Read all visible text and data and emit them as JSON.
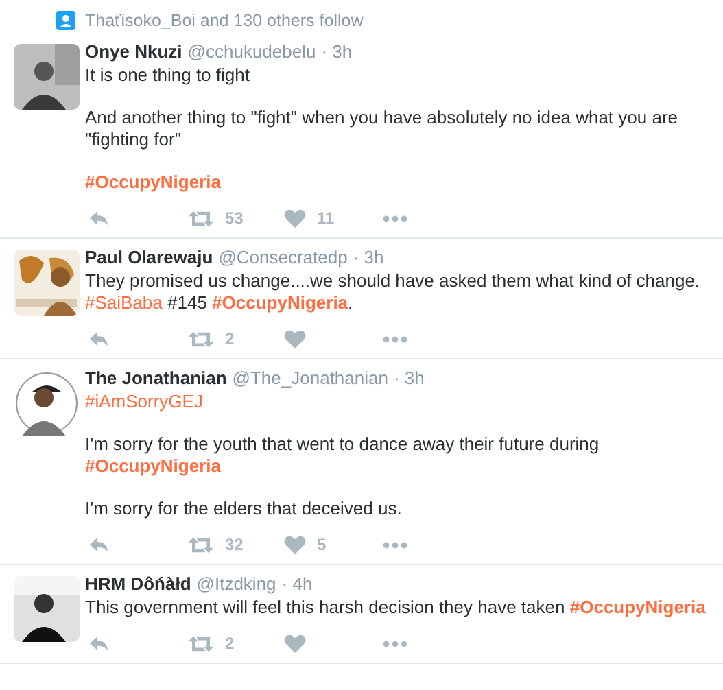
{
  "context": {
    "text": "Thaťisoko_Boi and 130 others follow"
  },
  "tweets": [
    {
      "name": "Onye Nkuzi",
      "handle": "@cchukudebelu",
      "time": "· 3h",
      "avatar": {
        "kind": "picture"
      },
      "paragraphs": [
        [
          {
            "kind": "text",
            "text": "It is one thing to fight"
          }
        ],
        [
          {
            "kind": "text",
            "text": "And another thing to \"fight\" when you have absolutely no idea what you are \"fighting for\""
          }
        ],
        [
          {
            "kind": "hashtag",
            "text": "**#OccupyNigeria**"
          }
        ]
      ],
      "retweets": "53",
      "likes": "11"
    },
    {
      "name": "Paul Olarewaju",
      "handle": "@Consecratedp",
      "time": "· 3h",
      "avatar": {
        "kind": "picture"
      },
      "paragraphs": [
        [
          {
            "kind": "text",
            "text": "They promised us change....we should have asked them what kind of change. "
          },
          {
            "kind": "hashtag",
            "text": "#SaiBaba"
          },
          {
            "kind": "text",
            "text": " #145 "
          },
          {
            "kind": "hashtag",
            "text": "**#OccupyNigeria**"
          },
          {
            "kind": "text",
            "text": "."
          }
        ]
      ],
      "retweets": "2"
    },
    {
      "name": "The Jonathanian",
      "handle": "@The_Jonathanian",
      "time": "· 3h",
      "avatar": {
        "kind": "picture"
      },
      "paragraphs": [
        [
          {
            "kind": "hashtag",
            "text": "#iAmSorryGEJ"
          }
        ],
        [
          {
            "kind": "text",
            "text": "I'm sorry for the youth that went to dance away their future during "
          },
          {
            "kind": "hashtag",
            "text": "**#OccupyNigeria**"
          }
        ],
        [
          {
            "kind": "text",
            "text": "I'm sorry for the elders that deceived us."
          }
        ]
      ],
      "retweets": "32",
      "likes": "5"
    },
    {
      "name": "HRM Dôńàłd",
      "handle": "@Itzdking",
      "time": "· 4h",
      "avatar": {
        "kind": "picture"
      },
      "paragraphs": [
        [
          {
            "kind": "text",
            "text": "This government will feel this harsh decision they have taken "
          },
          {
            "kind": "hashtag",
            "text": "**#OccupyNigeria**"
          }
        ]
      ],
      "retweets": "2"
    }
  ]
}
